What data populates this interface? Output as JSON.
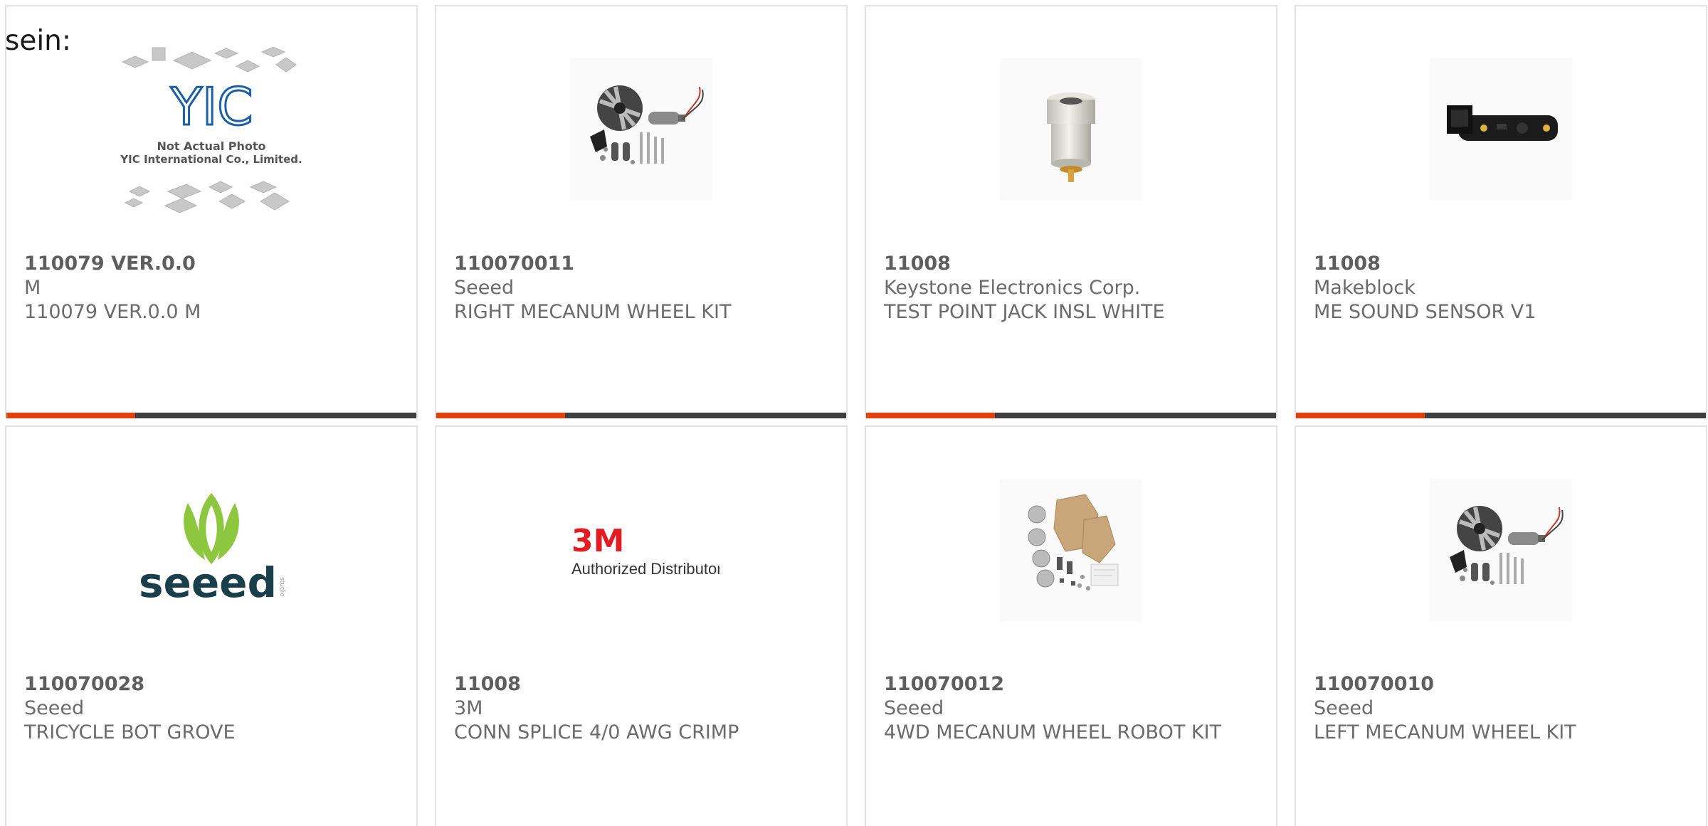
{
  "heading": "sein:",
  "colors": {
    "accent": "#e2420f",
    "bar": "#3f3f3f",
    "border": "#e2e2e2",
    "text": "#6b6b6b"
  },
  "products": [
    {
      "part_number": "110079 VER.0.0",
      "manufacturer": "M",
      "description": "110079 VER.0.0 M",
      "image": "yic-placeholder-image",
      "image_text": [
        "Not Actual Photo",
        "YIC International Co., Limited."
      ],
      "image_logo": "YIC"
    },
    {
      "part_number": "110070011",
      "manufacturer": "Seeed",
      "description": "RIGHT MECANUM WHEEL KIT",
      "image": "mecanum-wheel-kit-image"
    },
    {
      "part_number": "11008",
      "manufacturer": "Keystone Electronics Corp.",
      "description": "TEST POINT JACK INSL WHITE",
      "image": "test-point-jack-image"
    },
    {
      "part_number": "11008",
      "manufacturer": "Makeblock",
      "description": "ME SOUND SENSOR V1",
      "image": "sound-sensor-image"
    },
    {
      "part_number": "110070028",
      "manufacturer": "Seeed",
      "description": "TRICYCLE BOT GROVE",
      "image": "seeed-logo-image",
      "image_logo": "seeed",
      "image_sub": "studio"
    },
    {
      "part_number": "11008",
      "manufacturer": "3M",
      "description": "CONN SPLICE 4/0 AWG CRIMP",
      "image": "3m-distributor-image",
      "image_logo": "3M",
      "image_sub": "Authorized Distributor"
    },
    {
      "part_number": "110070012",
      "manufacturer": "Seeed",
      "description": "4WD MECANUM WHEEL ROBOT KIT",
      "image": "robot-kit-parts-image"
    },
    {
      "part_number": "110070010",
      "manufacturer": "Seeed",
      "description": "LEFT MECANUM WHEEL KIT",
      "image": "mecanum-wheel-kit-image"
    }
  ]
}
